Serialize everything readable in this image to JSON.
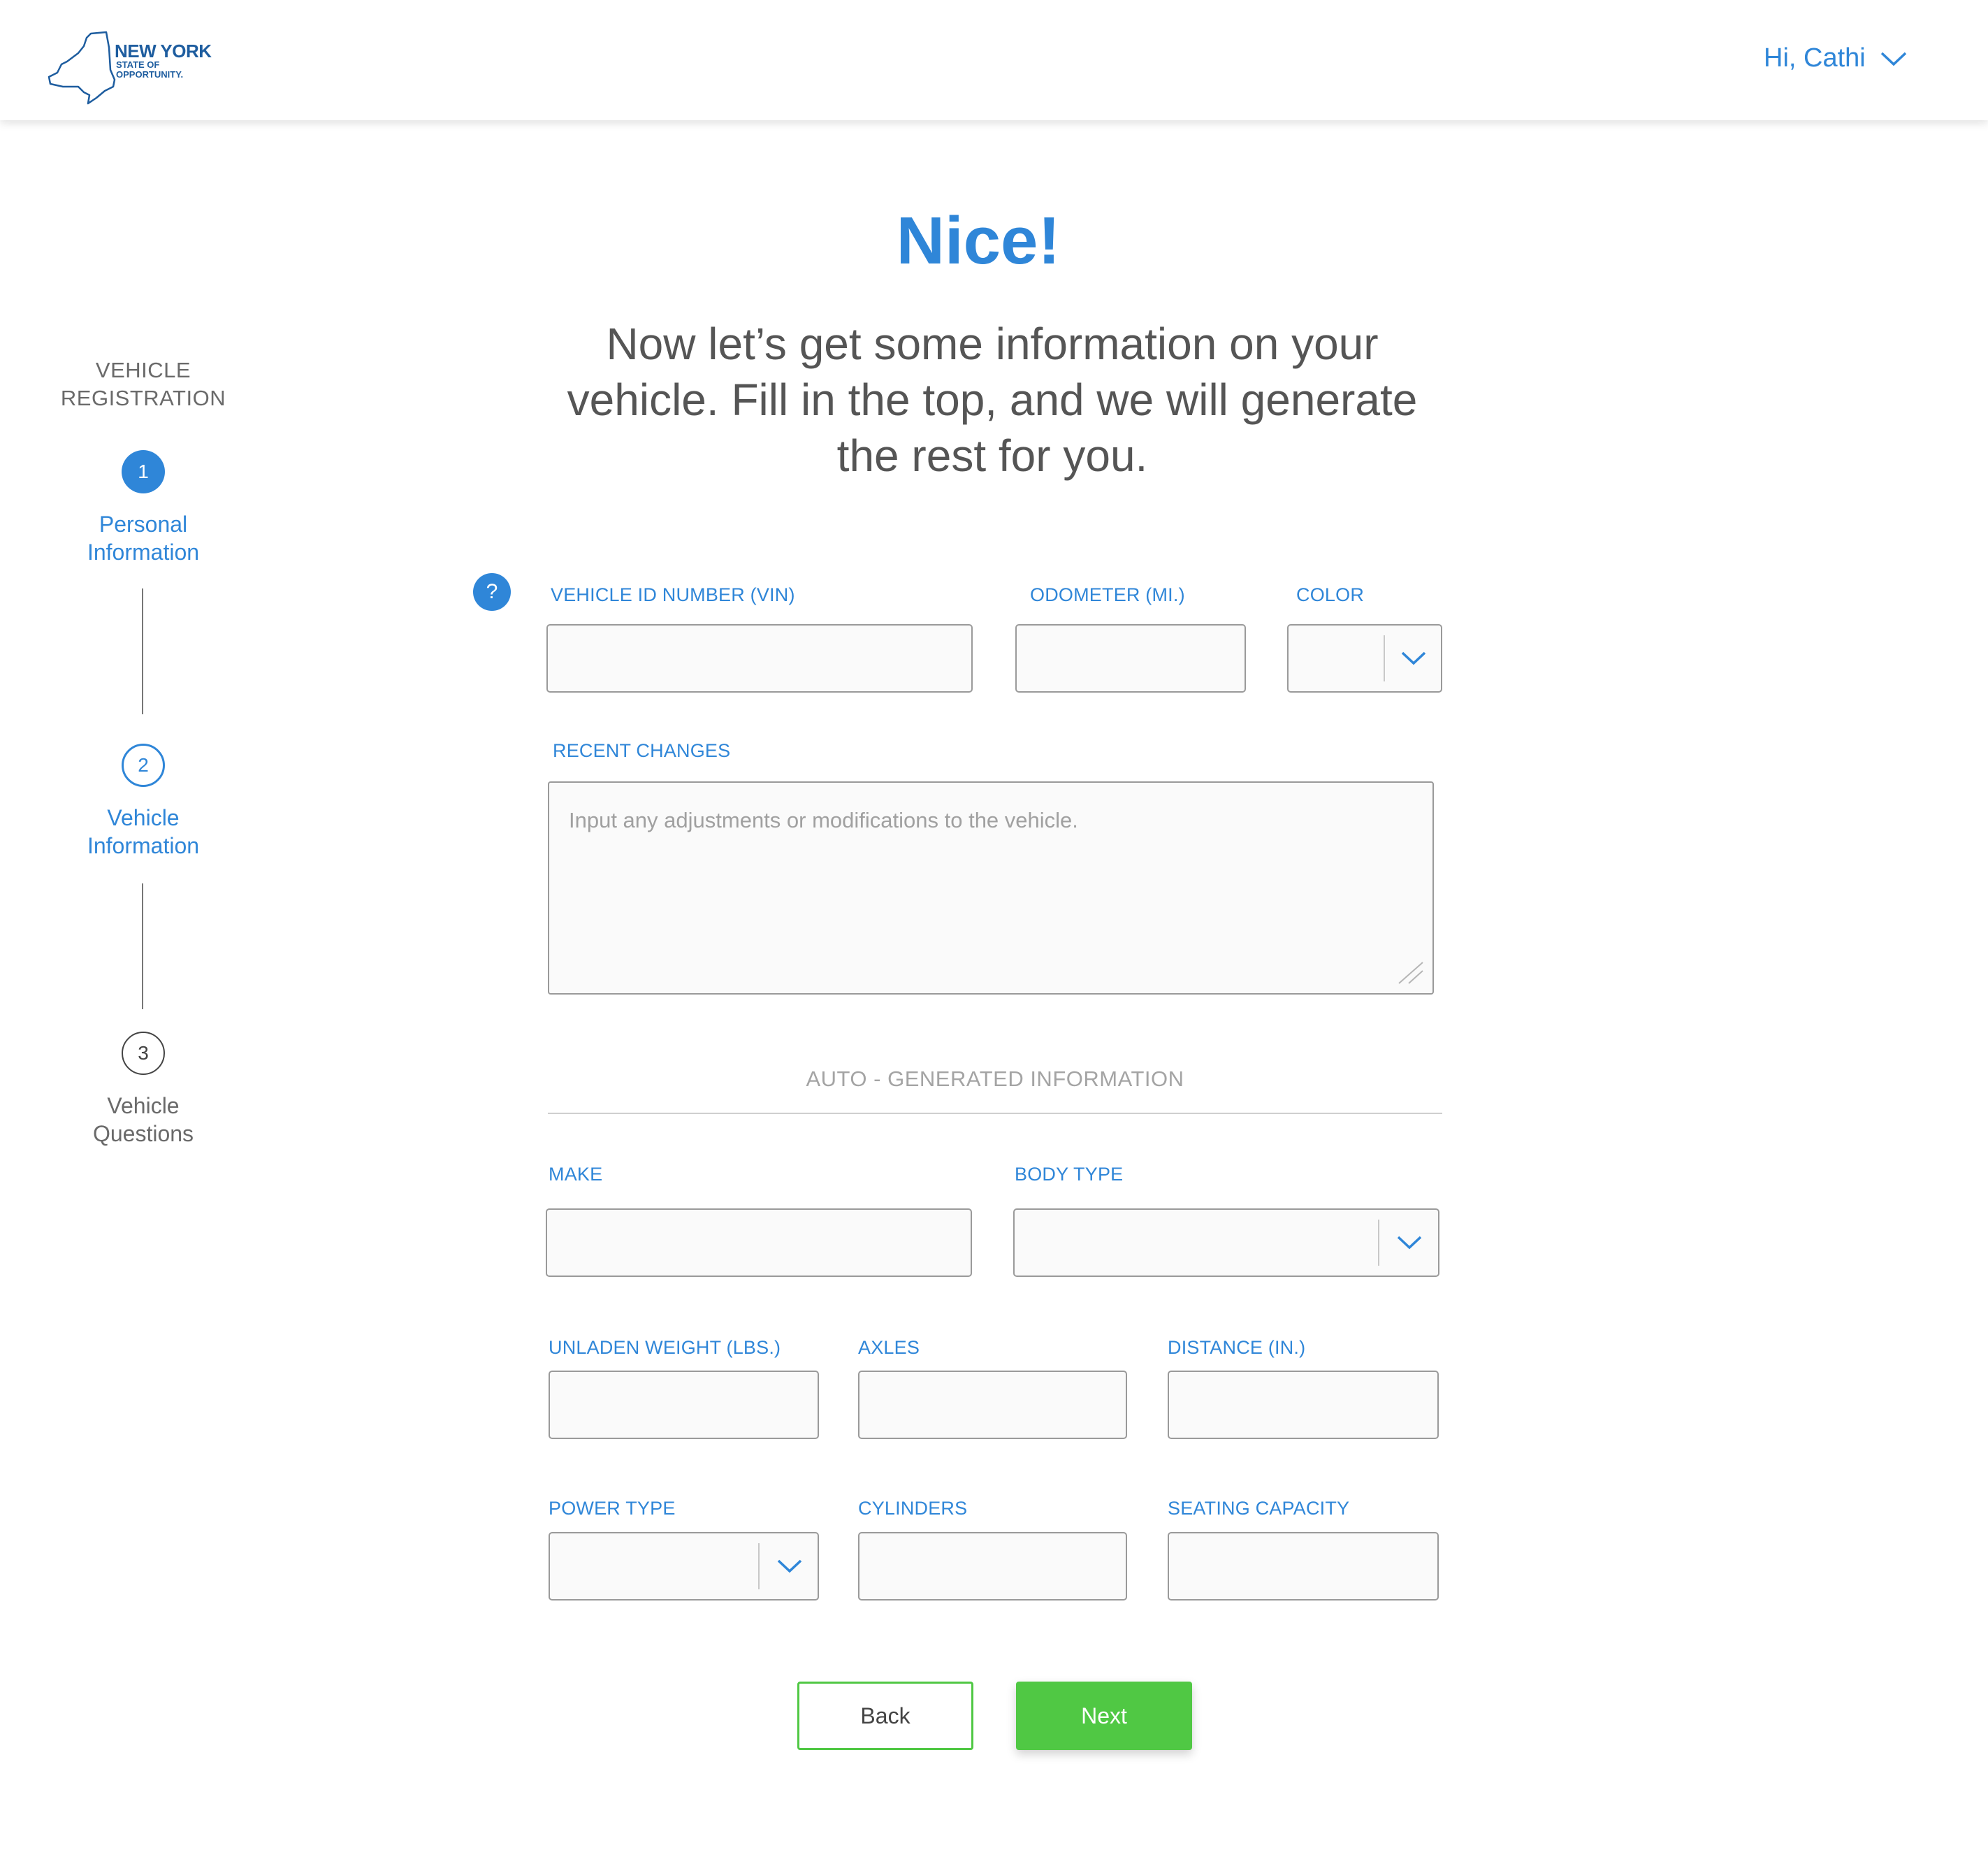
{
  "header": {
    "logo": {
      "line1": "NEW YORK",
      "line2": "STATE OF",
      "line3": "OPPORTUNITY."
    },
    "user_greeting": "Hi, Cathi"
  },
  "sidebar": {
    "title_line1": "VEHICLE",
    "title_line2": "REGISTRATION",
    "steps": [
      {
        "number": "1",
        "label_line1": "Personal",
        "label_line2": "Information",
        "state": "completed"
      },
      {
        "number": "2",
        "label_line1": "Vehicle",
        "label_line2": "Information",
        "state": "current"
      },
      {
        "number": "3",
        "label_line1": "Vehicle",
        "label_line2": "Questions",
        "state": "upcoming"
      }
    ]
  },
  "main": {
    "title": "Nice!",
    "subtitle_line1": "Now let’s get some information on your",
    "subtitle_line2": "vehicle. Fill in the top, and we will generate",
    "subtitle_line3": "the rest for you.",
    "help_icon": "?",
    "fields": {
      "vin": {
        "label": "VEHICLE ID NUMBER (VIN)",
        "value": ""
      },
      "odometer": {
        "label": "ODOMETER (MI.)",
        "value": ""
      },
      "color": {
        "label": "COLOR",
        "value": ""
      },
      "recent_changes": {
        "label": "RECENT CHANGES",
        "placeholder": "Input any adjustments or modifications to the vehicle.",
        "value": ""
      }
    },
    "auto_section_title": "AUTO - GENERATED INFORMATION",
    "auto_fields": {
      "make": {
        "label": "MAKE",
        "value": ""
      },
      "body_type": {
        "label": "BODY TYPE",
        "value": ""
      },
      "unladen_weight": {
        "label": "UNLADEN WEIGHT (LBS.)",
        "value": ""
      },
      "axles": {
        "label": "AXLES",
        "value": ""
      },
      "distance": {
        "label": "DISTANCE (IN.)",
        "value": ""
      },
      "power_type": {
        "label": "POWER TYPE",
        "value": ""
      },
      "cylinders": {
        "label": "CYLINDERS",
        "value": ""
      },
      "seating_capacity": {
        "label": "SEATING CAPACITY",
        "value": ""
      }
    },
    "buttons": {
      "back": "Back",
      "next": "Next"
    }
  },
  "colors": {
    "accent": "#2f86d8",
    "primary_button": "#50c844",
    "logo": "#1e5d9f"
  },
  "icons": {
    "user_menu": "chevron-down-icon",
    "select": "chevron-down-icon",
    "help": "question-circle-icon",
    "logo": "ny-state-outline-icon"
  }
}
